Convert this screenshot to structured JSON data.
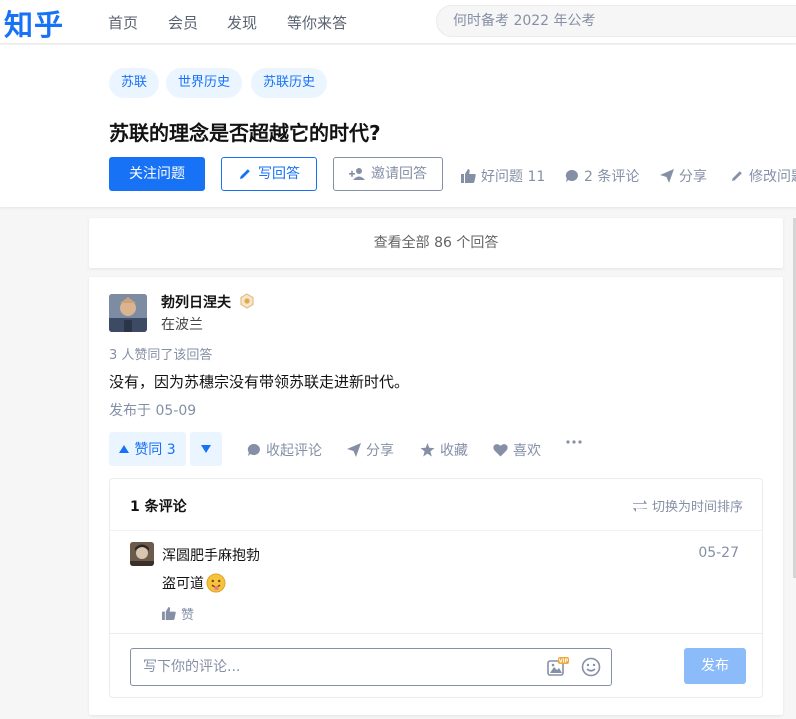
{
  "header": {
    "logo": "知乎",
    "nav": [
      "首页",
      "会员",
      "发现",
      "等你来答"
    ],
    "search_placeholder": "何时备考 2022 年公考"
  },
  "question": {
    "topics": [
      "苏联",
      "世界历史",
      "苏联历史"
    ],
    "title": "苏联的理念是否超越它的时代?",
    "follow_label": "关注问题",
    "write_label": "写回答",
    "invite_label": "邀请回答",
    "good_question_label": "好问题 11",
    "comments_label": "2 条评论",
    "share_label": "分享",
    "edit_label": "修改问题"
  },
  "view_all_label": "查看全部 86 个回答",
  "answer": {
    "author_name": "勃列日涅夫",
    "author_headline": "在波兰",
    "voters_text": "3 人赞同了该回答",
    "content": "没有，因为苏穗宗没有带领苏联走进新时代。",
    "date": "发布于 05-09",
    "vote_label": "赞同 3",
    "actions": {
      "collapse_comments": "收起评论",
      "share": "分享",
      "favorite": "收藏",
      "like": "喜欢"
    }
  },
  "comments": {
    "count_label": "1 条评论",
    "sort_label": "切换为时间排序",
    "items": [
      {
        "author": "浑圆肥手麻抱勃",
        "date": "05-27",
        "text": "盗可道",
        "like_label": "赞"
      }
    ],
    "input_placeholder": "写下你的评论...",
    "submit_label": "发布",
    "vip_badge": "VIP"
  },
  "colors": {
    "brand": "#1772f6",
    "muted": "#8590a6",
    "submit_disabled": "#8cbbfa"
  }
}
